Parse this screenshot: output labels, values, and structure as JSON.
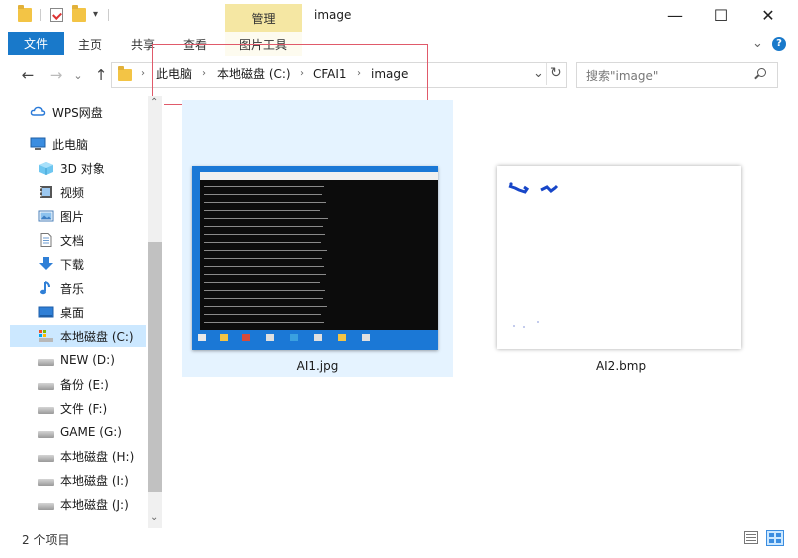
{
  "window": {
    "title": "image",
    "context_tab": "管理",
    "minimize": "—",
    "maximize": "☐",
    "close": "✕"
  },
  "ribbon": {
    "file": "文件",
    "tabs": [
      "主页",
      "共享",
      "查看",
      "图片工具"
    ],
    "expand": "⌄",
    "help": "?"
  },
  "nav": {
    "back": "←",
    "forward": "→",
    "recent": "⌄",
    "up": "↑",
    "breadcrumbs": [
      "此电脑",
      "本地磁盘 (C:)",
      "CFAI1",
      "image"
    ],
    "separator": "›",
    "dropdown": "⌄",
    "refresh": "↻",
    "search_placeholder": "搜索\"image\""
  },
  "sidebar": {
    "items": [
      {
        "label": "WPS网盘",
        "icon": "cloud-icon"
      },
      {
        "label": "此电脑",
        "icon": "computer-icon"
      },
      {
        "label": "3D 对象",
        "icon": "cube-icon"
      },
      {
        "label": "视频",
        "icon": "video-icon"
      },
      {
        "label": "图片",
        "icon": "picture-icon"
      },
      {
        "label": "文档",
        "icon": "document-icon"
      },
      {
        "label": "下载",
        "icon": "download-icon"
      },
      {
        "label": "音乐",
        "icon": "music-icon"
      },
      {
        "label": "桌面",
        "icon": "desktop-icon"
      },
      {
        "label": "本地磁盘 (C:)",
        "icon": "drive-c-icon"
      },
      {
        "label": "NEW (D:)",
        "icon": "drive-icon"
      },
      {
        "label": "备份 (E:)",
        "icon": "drive-icon"
      },
      {
        "label": "文件 (F:)",
        "icon": "drive-icon"
      },
      {
        "label": "GAME (G:)",
        "icon": "drive-icon"
      },
      {
        "label": "本地磁盘 (H:)",
        "icon": "drive-icon"
      },
      {
        "label": "本地磁盘 (I:)",
        "icon": "drive-icon"
      },
      {
        "label": "本地磁盘 (J:)",
        "icon": "drive-icon"
      }
    ],
    "scroll_up": "⌃",
    "scroll_down": "⌄"
  },
  "files": [
    {
      "name": "AI1.jpg"
    },
    {
      "name": "AI2.bmp"
    }
  ],
  "status": {
    "count": "2 个项目"
  },
  "colors": {
    "accent": "#1979ca",
    "context_tab": "#f5e7a3",
    "selection": "#cce8ff",
    "highlight_box": "#e05a6a"
  }
}
